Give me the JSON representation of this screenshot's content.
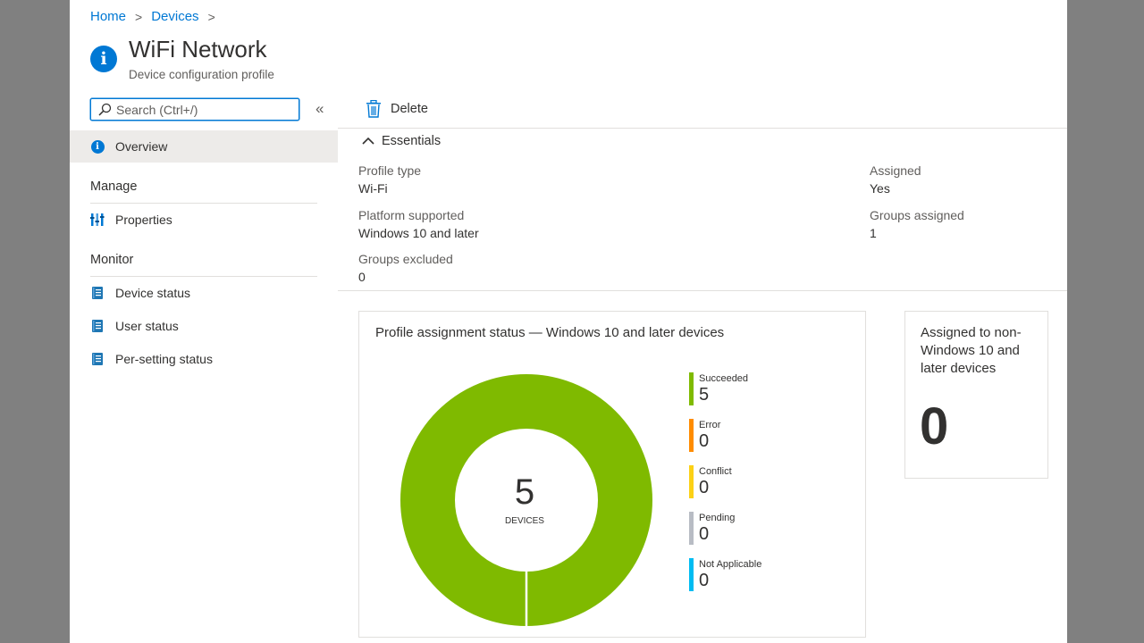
{
  "breadcrumb": {
    "home": "Home",
    "devices": "Devices",
    "separator": ">"
  },
  "header": {
    "title": "WiFi Network",
    "subtitle": "Device configuration profile",
    "icon": "info-icon"
  },
  "nav": {
    "search_placeholder": "Search (Ctrl+/)",
    "collapse_glyph": "«",
    "overview": "Overview",
    "manage_section": "Manage",
    "properties": "Properties",
    "monitor_section": "Monitor",
    "device_status": "Device status",
    "user_status": "User status",
    "per_setting_status": "Per-setting status"
  },
  "toolbar": {
    "delete_label": "Delete"
  },
  "essentials": {
    "header": "Essentials",
    "fields": {
      "profile_type": {
        "label": "Profile type",
        "value": "Wi-Fi"
      },
      "platform_supported": {
        "label": "Platform supported",
        "value": "Windows 10 and later"
      },
      "groups_excluded": {
        "label": "Groups excluded",
        "value": "0"
      },
      "assigned": {
        "label": "Assigned",
        "value": "Yes"
      },
      "groups_assigned": {
        "label": "Groups assigned",
        "value": "1"
      }
    }
  },
  "status_card": {
    "title": "Profile assignment status — Windows 10 and later devices",
    "total": "5",
    "total_label": "DEVICES",
    "legend": [
      {
        "name": "Succeeded",
        "value": "5",
        "color": "#7fba00"
      },
      {
        "name": "Error",
        "value": "0",
        "color": "#ff8c00"
      },
      {
        "name": "Conflict",
        "value": "0",
        "color": "#fcd116"
      },
      {
        "name": "Pending",
        "value": "0",
        "color": "#b8bcc4"
      },
      {
        "name": "Not Applicable",
        "value": "0",
        "color": "#00bcf2"
      }
    ]
  },
  "chart_data": {
    "type": "pie",
    "categories": [
      "Succeeded",
      "Error",
      "Conflict",
      "Pending",
      "Not Applicable"
    ],
    "values": [
      5,
      0,
      0,
      0,
      0
    ],
    "title": "Profile assignment status — Windows 10 and later devices"
  },
  "non_windows_card": {
    "title": "Assigned to non-Windows 10 and later devices",
    "value": "0"
  },
  "colors": {
    "accent": "#0078d4",
    "succeeded": "#7fba00"
  }
}
